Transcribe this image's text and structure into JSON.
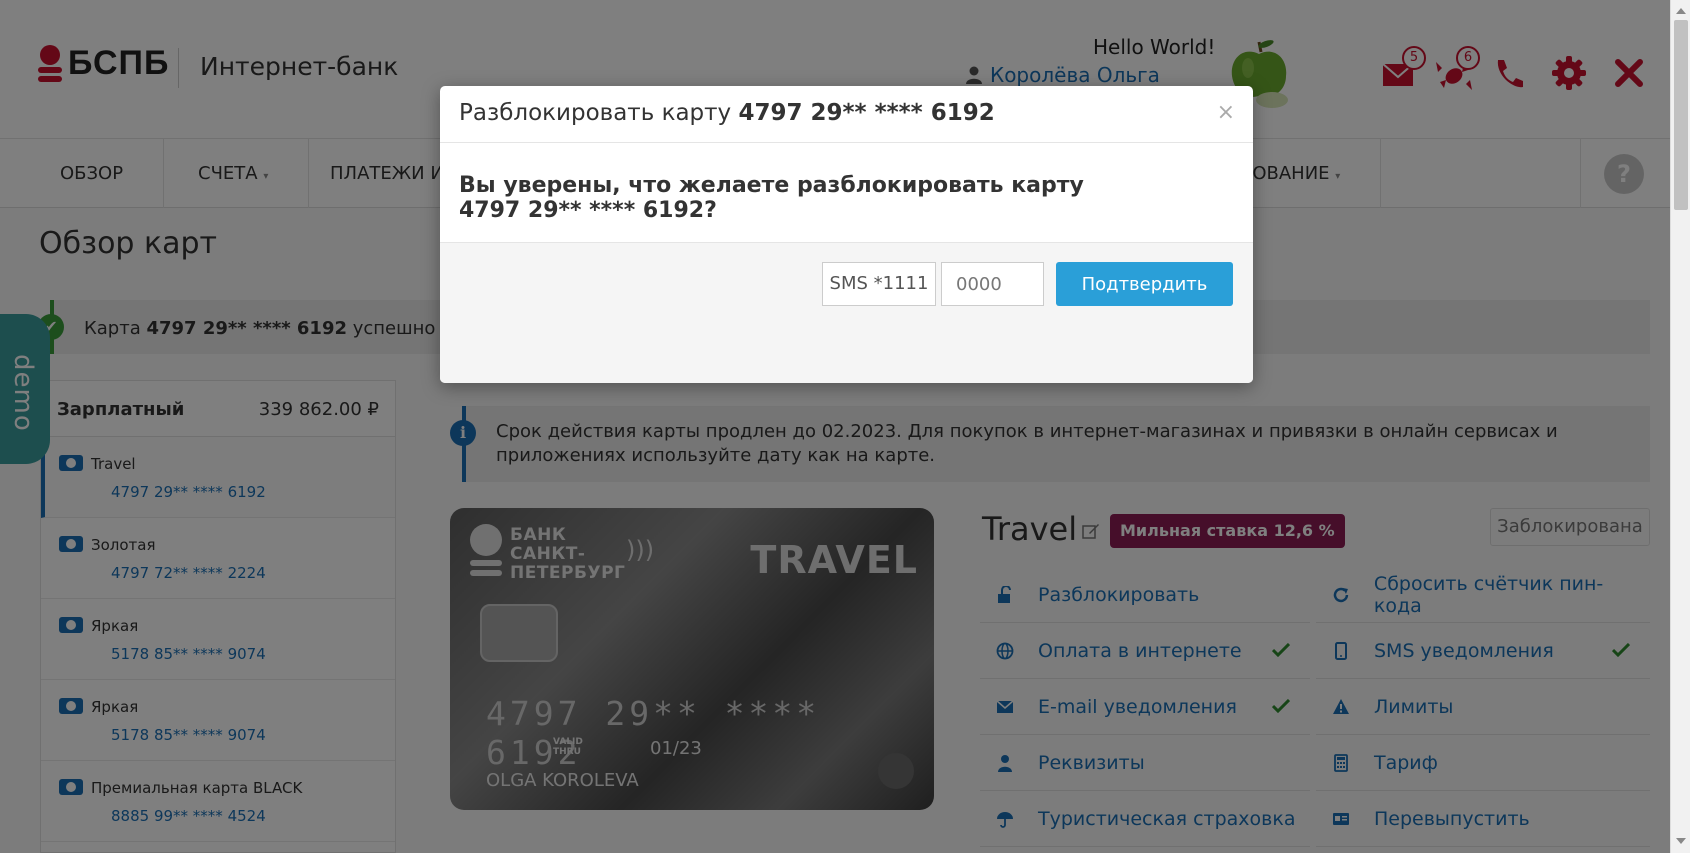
{
  "header": {
    "logo_text": "БСПБ",
    "bank_title": "Интернет-банк",
    "greeting": "Hello World!",
    "user_name": "Королёва Ольга",
    "messages_count": "5",
    "offers_count": "6"
  },
  "nav": {
    "items": [
      {
        "label": "ОБЗОР"
      },
      {
        "label": "СЧЕТА"
      },
      {
        "label": "ПЛАТЕЖИ И П"
      },
      {
        "label": "ХОВАНИЕ"
      }
    ],
    "help_label": "?"
  },
  "page": {
    "title": "Обзор карт",
    "success_prefix": "Карта ",
    "success_card": "4797 29** **** 6192",
    "success_suffix": " успешно забло",
    "demo_label": "demo"
  },
  "sidebar": {
    "account_name": "Зарплатный",
    "account_balance": "339 862.00 ₽",
    "cards": [
      {
        "name": "Travel",
        "number": "4797 29** **** 6192"
      },
      {
        "name": "Золотая",
        "number": "4797 72** **** 2224"
      },
      {
        "name": "Яркая",
        "number": "5178 85** **** 9074"
      },
      {
        "name": "Яркая",
        "number": "5178 85** **** 9074"
      },
      {
        "name": "Премиальная карта BLACK",
        "number": "8885 99** **** 4524"
      }
    ]
  },
  "info": {
    "text": "Срок действия карты продлен до 02.2023. Для покупок в интернет-магазинах и привязки в онлайн сервисах и приложениях используйте дату как на карте."
  },
  "card": {
    "bank_line1": "БАНК",
    "bank_line2": "САНКТ-",
    "bank_line3": "ПЕТЕРБУРГ",
    "brand": "TRAVEL",
    "number": "4797 29** **** 6192",
    "valid_line1": "VALID",
    "valid_line2": "THRU",
    "expiry": "01/23",
    "holder": "OLGA KOROLEVA",
    "title": "Travel",
    "promo": "Мильная ставка 12,6 %",
    "status": "Заблокирована"
  },
  "actions": {
    "unblock": "Разблокировать",
    "reset_pin": "Сбросить счётчик пин-кода",
    "internet_pay": "Оплата в интернете",
    "sms_notify": "SMS уведомления",
    "email_notify": "E-mail уведомления",
    "limits": "Лимиты",
    "requisites": "Реквизиты",
    "tariff": "Тариф",
    "travel_insurance": "Туристическая страховка",
    "reissue": "Перевыпустить"
  },
  "modal": {
    "title_prefix": "Разблокировать карту ",
    "title_card": "4797 29** **** 6192",
    "close_label": "×",
    "question_line1": "Вы уверены, что желаете разблокировать карту",
    "question_line2": "4797 29** **** 6192?",
    "sms_label": "SMS *1111",
    "code_placeholder": "0000",
    "confirm_label": "Подтвердить"
  },
  "colors": {
    "brand_red": "#c8102e",
    "link_blue": "#1a6fb5",
    "confirm_blue": "#2a9fd8",
    "promo_purple": "#8d1c55",
    "success_green": "#3a9d3a",
    "demo_teal": "#3a9d9d"
  },
  "icons": {
    "user": "person-icon",
    "messages": "envelope-icon",
    "offers": "candy-icon",
    "phone": "phone-icon",
    "settings": "gear-icon",
    "logout": "close-icon"
  }
}
